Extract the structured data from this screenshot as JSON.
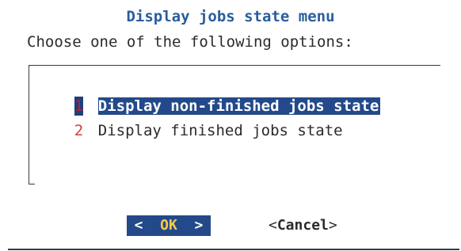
{
  "dialog": {
    "title": "Display jobs state menu",
    "prompt": "Choose one of the following options:"
  },
  "menu": {
    "items": [
      {
        "key": "1",
        "label": "Display non-finished jobs state",
        "selected": true
      },
      {
        "key": "2",
        "label": "Display finished jobs state",
        "selected": false
      }
    ]
  },
  "buttons": {
    "ok": {
      "left": "<",
      "label": "OK",
      "right": ">"
    },
    "cancel": {
      "left": "<",
      "label": "Cancel",
      "right": ">"
    }
  },
  "colors": {
    "title": "#2a5d9c",
    "selection_bg": "#23498a",
    "hotkey": "#d83b3b",
    "ok_label": "#f6c94a"
  }
}
